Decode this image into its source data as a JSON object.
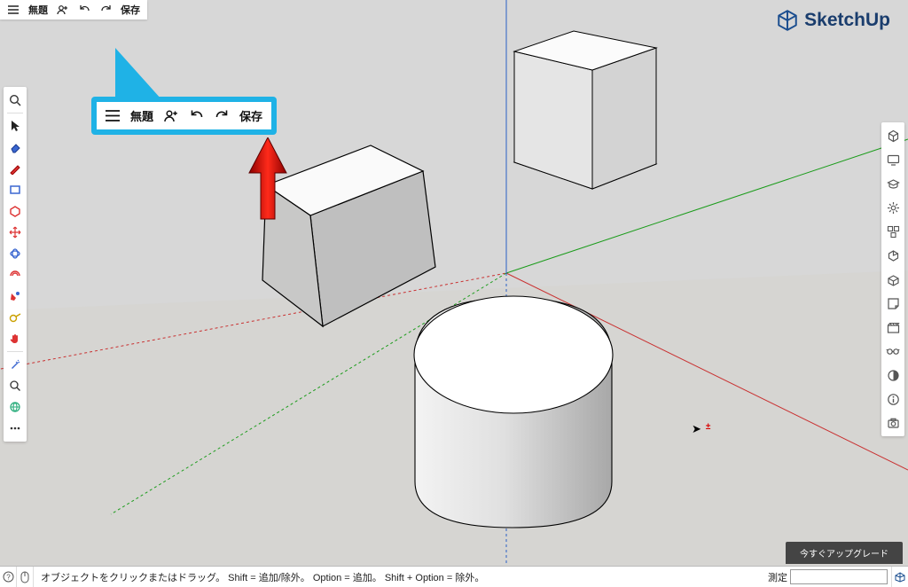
{
  "topbar": {
    "title": "無題",
    "save_label": "保存"
  },
  "callout": {
    "title": "無題",
    "save_label": "保存"
  },
  "brand": {
    "name": "SketchUp"
  },
  "upgrade": {
    "label": "今すぐアップグレード"
  },
  "statusbar": {
    "hint": "オブジェクトをクリックまたはドラッグ。 Shift = 追加/除外。 Option = 追加。 Shift + Option = 除外。",
    "measurement_label": "測定"
  },
  "left_tools": [
    {
      "name": "search",
      "glyph": "search"
    },
    {
      "type": "sep"
    },
    {
      "name": "select",
      "glyph": "pointer"
    },
    {
      "name": "eraser",
      "glyph": "eraser"
    },
    {
      "name": "pencil",
      "glyph": "pencil-red"
    },
    {
      "name": "rectangle",
      "glyph": "rect"
    },
    {
      "name": "circle",
      "glyph": "poly"
    },
    {
      "name": "pushpull",
      "glyph": "move-red"
    },
    {
      "name": "move",
      "glyph": "rotate-blue3d"
    },
    {
      "name": "rotate",
      "glyph": "offset-red"
    },
    {
      "name": "paint",
      "glyph": "paint"
    },
    {
      "name": "tape",
      "glyph": "tape"
    },
    {
      "name": "text",
      "glyph": "hand"
    },
    {
      "type": "sep"
    },
    {
      "name": "orbit",
      "glyph": "wand"
    },
    {
      "name": "pan",
      "glyph": "zoom"
    },
    {
      "name": "zoom",
      "glyph": "earth"
    },
    {
      "name": "more",
      "glyph": "dots"
    }
  ],
  "right_tools": [
    {
      "name": "entity-info",
      "glyph": "cube"
    },
    {
      "name": "display",
      "glyph": "tv"
    },
    {
      "name": "instructor",
      "glyph": "grad"
    },
    {
      "name": "outliner",
      "glyph": "gear"
    },
    {
      "name": "components",
      "glyph": "boxes"
    },
    {
      "name": "3dwarehouse",
      "glyph": "box-arrow"
    },
    {
      "name": "tags",
      "glyph": "box-open"
    },
    {
      "name": "materials",
      "glyph": "stickynote"
    },
    {
      "name": "styles",
      "glyph": "clap"
    },
    {
      "name": "scenes",
      "glyph": "glasses"
    },
    {
      "name": "shadows",
      "glyph": "circle-half"
    },
    {
      "name": "add",
      "glyph": "info"
    },
    {
      "name": "layers",
      "glyph": "camera"
    }
  ]
}
